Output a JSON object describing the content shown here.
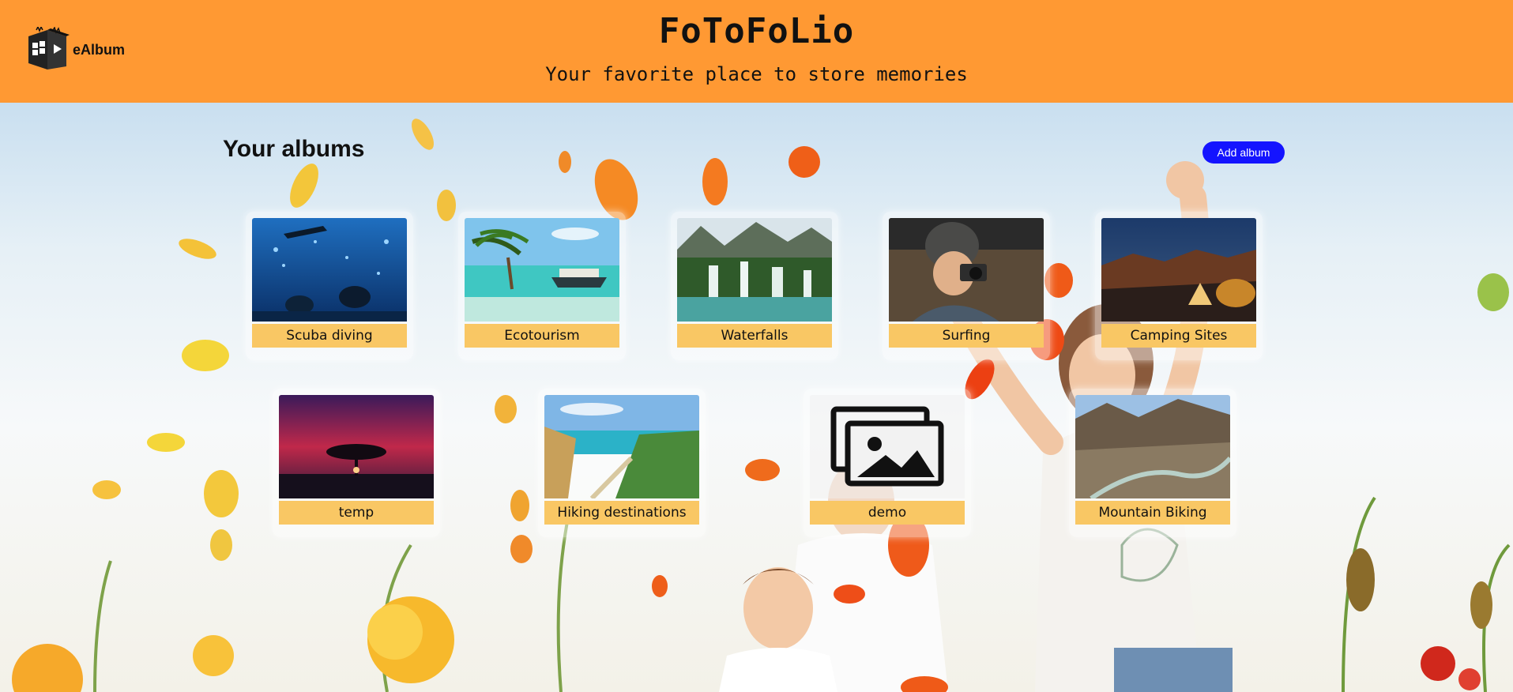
{
  "header": {
    "logo_text": "eAlbum",
    "title": "FoToFoLio",
    "subtitle": "Your favorite place to store memories",
    "background_color": "#ff9933"
  },
  "main": {
    "section_title": "Your albums",
    "add_album_label": "Add album",
    "add_album_color": "#1414ff",
    "label_color": "#f9c764",
    "albums": [
      {
        "label": "Scuba diving",
        "thumbnail": "underwater-divers-photo"
      },
      {
        "label": "Ecotourism",
        "thumbnail": "tropical-beach-boat-photo"
      },
      {
        "label": "Waterfalls",
        "thumbnail": "waterfalls-mountains-photo"
      },
      {
        "label": "Surfing",
        "thumbnail": "person-with-camera-photo"
      },
      {
        "label": "Camping Sites",
        "thumbnail": "tent-night-canyon-photo"
      },
      {
        "label": "temp",
        "thumbnail": "tree-sunset-photo"
      },
      {
        "label": "Hiking destinations",
        "thumbnail": "coastal-cliff-path-photo"
      },
      {
        "label": "demo",
        "thumbnail": "default-gallery-icon"
      },
      {
        "label": "Mountain Biking",
        "thumbnail": "mountain-valley-river-photo"
      }
    ]
  }
}
